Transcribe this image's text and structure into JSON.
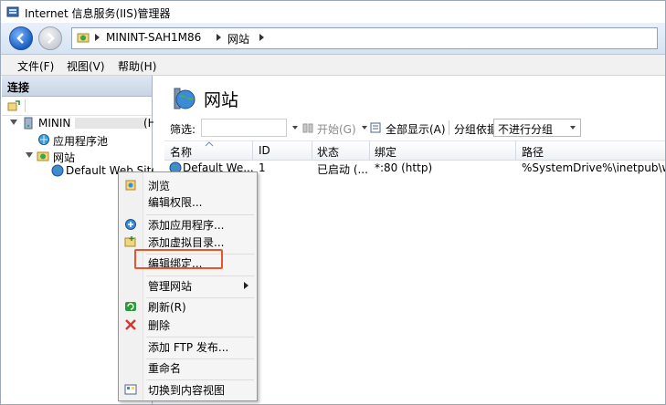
{
  "window": {
    "title": "Internet 信息服务(IIS)管理器"
  },
  "address_bar": {
    "segments": [
      "MININT-SAH1M86",
      "网站"
    ]
  },
  "menubar": {
    "items": [
      "文件(F)",
      "视图(V)",
      "帮助(H)"
    ]
  },
  "connections": {
    "header": "连接",
    "tree": [
      {
        "label": "MININ",
        "suffix": "(H",
        "level": 0,
        "expanded": true,
        "icon": "server-icon"
      },
      {
        "label": "应用程序池",
        "level": 1,
        "icon": "app-pool-icon"
      },
      {
        "label": "网站",
        "level": 1,
        "expanded": true,
        "icon": "sites-folder-icon"
      },
      {
        "label": "Default Web Site",
        "level": 2,
        "icon": "globe-icon",
        "selected": true
      }
    ]
  },
  "main": {
    "title": "网站",
    "toolbar": {
      "filter_label": "筛选:",
      "start_label": "开始(G)",
      "show_all_label": "全部显示(A)",
      "group_by_label": "分组依据:",
      "group_by_value": "不进行分组"
    },
    "columns": [
      "名称",
      "ID",
      "状态",
      "绑定",
      "路径"
    ],
    "rows": [
      {
        "name": "Default We...",
        "id": "1",
        "status": "已启动 (...",
        "binding": "*:80 (http)",
        "path": "%SystemDrive%\\inetpub\\w"
      }
    ]
  },
  "context_menu": {
    "items": [
      {
        "label": "浏览",
        "icon": "browse-icon"
      },
      {
        "label": "编辑权限..."
      },
      {
        "label": "添加应用程序...",
        "icon": "add-app-icon"
      },
      {
        "label": "添加虚拟目录...",
        "icon": "add-vdir-icon"
      },
      {
        "label": "编辑绑定...",
        "highlighted": true
      },
      {
        "label": "管理网站",
        "has_submenu": true
      },
      {
        "label": "刷新(R)",
        "icon": "refresh-icon"
      },
      {
        "label": "删除",
        "icon": "delete-icon"
      },
      {
        "label": "添加 FTP 发布..."
      },
      {
        "label": "重命名"
      },
      {
        "label": "切换到内容视图",
        "icon": "content-view-icon"
      }
    ]
  },
  "colors": {
    "highlight": "#e8542b",
    "accent": "#1b5fbf"
  }
}
